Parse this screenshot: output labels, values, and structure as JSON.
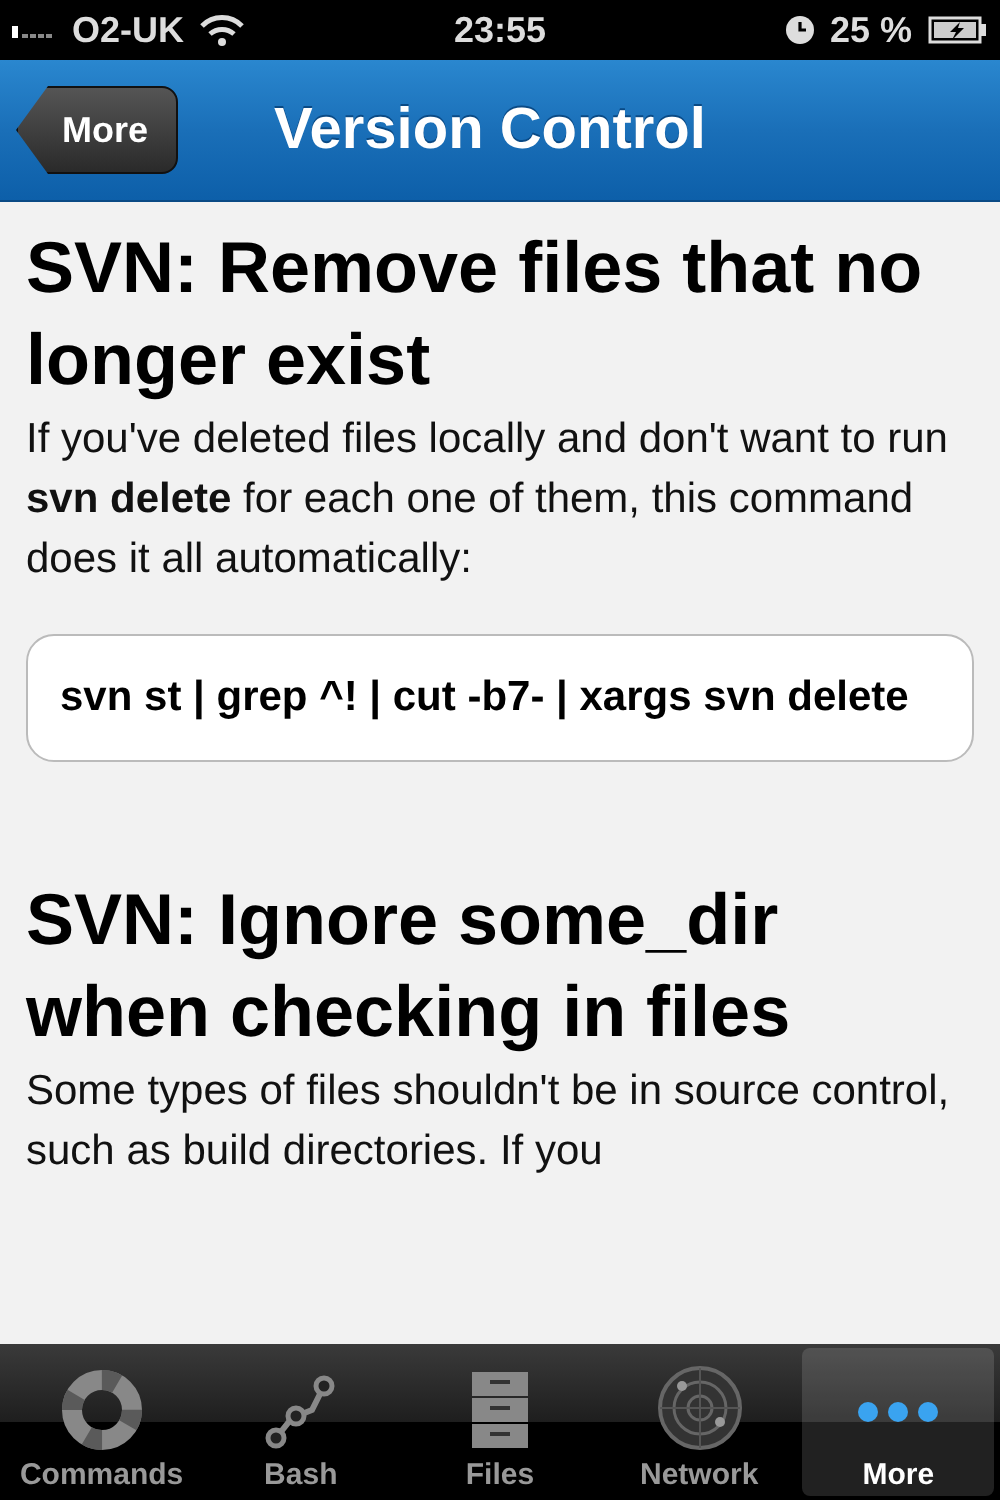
{
  "status_bar": {
    "carrier": "O2-UK",
    "time": "23:55",
    "battery": "25 %"
  },
  "nav_bar": {
    "back": "More",
    "title": "Version Control"
  },
  "sections": [
    {
      "heading": "SVN: Remove files that no longer exist",
      "text": "If you've deleted files locally and don't want to run **svn delete** for each one of them, this command does it all automatically:",
      "code": "svn st | grep ^! | cut -b7- | xargs svn delete"
    },
    {
      "heading": "SVN: Ignore some_dir when checking in files",
      "text": "Some types of files shouldn't be in source control, such as build directories. If you"
    }
  ],
  "tabs": [
    {
      "label": "Commands",
      "kind": "lifebuoy",
      "selected": false
    },
    {
      "label": "Bash",
      "kind": "nodes",
      "selected": false
    },
    {
      "label": "Files",
      "kind": "cabinet",
      "selected": false
    },
    {
      "label": "Network",
      "kind": "radar",
      "selected": false
    },
    {
      "label": "More",
      "kind": "dots",
      "selected": true
    }
  ]
}
